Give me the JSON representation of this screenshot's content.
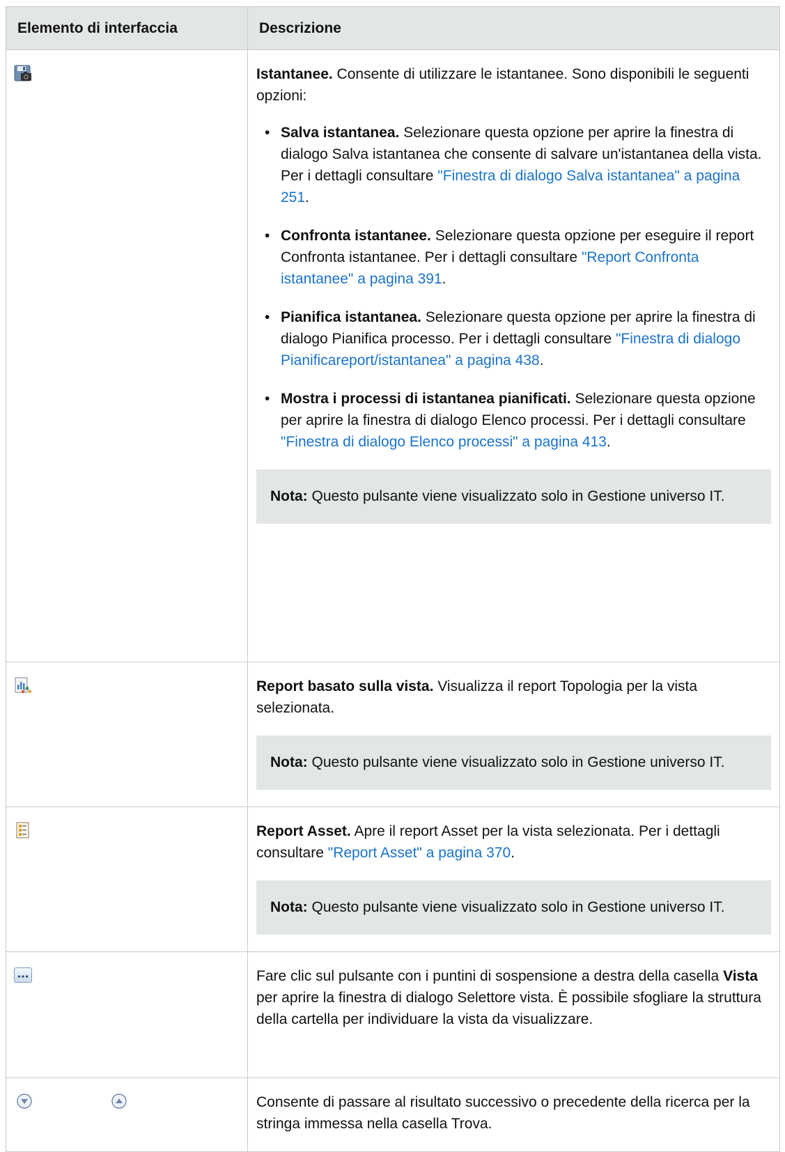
{
  "table": {
    "col_ui_element": "Elemento di interfaccia",
    "col_description": "Descrizione"
  },
  "rows": {
    "snapshots": {
      "icon": "snapshot-icon",
      "title": "Istantanee.",
      "intro": " Consente di utilizzare le istantanee. Sono disponibili le seguenti opzioni:",
      "bullets": [
        {
          "bold": "Salva istantanea.",
          "text": " Selezionare questa opzione per aprire la finestra di dialogo Salva istantanea che consente di salvare un'istantanea della vista. Per i dettagli consultare ",
          "link": "\"Finestra di dialogo Salva istantanea\" a pagina 251",
          "tail": "."
        },
        {
          "bold": "Confronta istantanee.",
          "text": " Selezionare questa opzione per eseguire il report Confronta istantanee. Per i dettagli consultare ",
          "link": "\"Report Confronta istantanee\" a pagina 391",
          "tail": "."
        },
        {
          "bold": "Pianifica istantanea.",
          "text": " Selezionare questa opzione per aprire la finestra di dialogo Pianifica processo. Per i dettagli consultare ",
          "link": "\"Finestra di dialogo Pianificareport/istantanea\" a pagina 438",
          "tail": "."
        },
        {
          "bold": "Mostra i processi di istantanea pianificati.",
          "text": " Selezionare questa opzione per aprire la finestra di dialogo Elenco processi. Per i dettagli consultare ",
          "link": "\"Finestra di dialogo Elenco processi\" a pagina 413",
          "tail": "."
        }
      ],
      "note_label": "Nota:",
      "note_text": " Questo pulsante viene visualizzato solo in Gestione universo IT."
    },
    "view_report": {
      "icon": "topology-report-icon",
      "title": "Report basato sulla vista.",
      "text": " Visualizza il report Topologia per la vista selezionata.",
      "note_label": "Nota:",
      "note_text": " Questo pulsante viene visualizzato solo in Gestione universo IT."
    },
    "asset_report": {
      "icon": "asset-report-icon",
      "title": "Report Asset.",
      "text": " Apre il report Asset per la vista selezionata. Per i dettagli consultare ",
      "link": "\"Report Asset\" a pagina 370",
      "tail": ".",
      "note_label": "Nota:",
      "note_text": " Questo pulsante viene visualizzato solo in Gestione universo IT."
    },
    "ellipsis": {
      "icon": "ellipsis-button-icon",
      "text_a": "Fare clic sul pulsante con i puntini di sospensione a destra della casella ",
      "bold": "Vista",
      "text_b": " per aprire la finestra di dialogo Selettore vista. È possibile sfogliare la struttura della cartella per individuare la vista da visualizzare."
    },
    "find_nav": {
      "icons": [
        "find-next-icon",
        "find-previous-icon"
      ],
      "text": "Consente di passare al risultato successivo o precedente della ricerca per la stringa immessa nella casella Trova."
    }
  },
  "colors": {
    "header_bg": "#e3e6e6",
    "note_bg": "#e3e6e6",
    "link": "#1a73c9",
    "border": "#c9c9c9"
  }
}
